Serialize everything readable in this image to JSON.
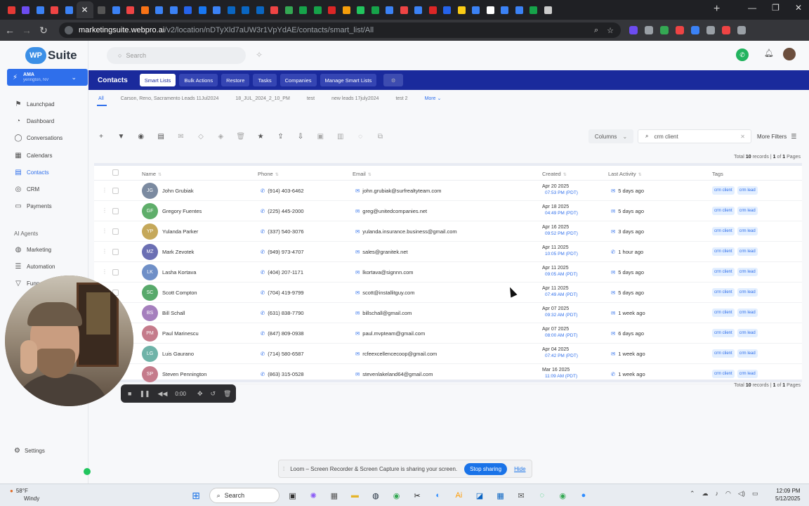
{
  "browser": {
    "url_host": "marketingsuite.webpro.ai",
    "url_path": "/v2/location/nDTyXld7aUW3r1VpYdAE/contacts/smart_list/All",
    "tab_colors": [
      "#e53935",
      "#6d4cf0",
      "#3b82f6",
      "#ef4444",
      "#3b82f6",
      "#555",
      "#3b82f6",
      "#ef4444",
      "#f97316",
      "#3b82f6",
      "#3b82f6",
      "#2563eb",
      "#1877f2",
      "#3b82f6",
      "#0a66c2",
      "#0a66c2",
      "#0a66c2",
      "#ef4444",
      "#34a853",
      "#16a34a",
      "#16a34a",
      "#dc2626",
      "#f59e0b",
      "#22c55e",
      "#16a34a",
      "#3b82f6",
      "#ef4444",
      "#3b82f6",
      "#dc2626",
      "#2563eb",
      "#facc15",
      "#3b82f6",
      "#ffffff",
      "#3b82f6",
      "#3b82f6",
      "#16a34a",
      "#cccccc"
    ],
    "ext_colors": [
      "#6d4cf0",
      "#9aa0a6",
      "#34a853",
      "#ef4444",
      "#3b82f6",
      "#9aa0a6",
      "#ef4444",
      "#9aa0a6"
    ]
  },
  "brand": {
    "logo_wp": "WP",
    "logo_suite": "Suite",
    "accent": "#2f6feb"
  },
  "location": {
    "name": "AMA",
    "sub": "yerington, NV"
  },
  "search": {
    "placeholder": "Search"
  },
  "sidebar": {
    "items": [
      {
        "label": "Launchpad",
        "icon": "rocket-icon"
      },
      {
        "label": "Dashboard",
        "icon": "gauge-icon"
      },
      {
        "label": "Conversations",
        "icon": "chat-icon"
      },
      {
        "label": "Calendars",
        "icon": "calendar-icon"
      },
      {
        "label": "Contacts",
        "icon": "contacts-icon"
      },
      {
        "label": "CRM",
        "icon": "pin-icon"
      },
      {
        "label": "Payments",
        "icon": "payments-icon"
      }
    ],
    "section_label": "AI Agents",
    "items2": [
      {
        "label": "Marketing",
        "icon": "globe-icon"
      },
      {
        "label": "Automation",
        "icon": "automation-icon"
      },
      {
        "label": "Funn",
        "icon": "funnel-icon"
      }
    ],
    "settings_label": "Settings"
  },
  "subnav": {
    "title": "Contacts",
    "buttons": [
      "Smart Lists",
      "Bulk Actions",
      "Restore",
      "Tasks",
      "Companies",
      "Manage Smart Lists"
    ]
  },
  "smart_lists": {
    "tabs": [
      "All",
      "Carson, Reno, Sacramento Leads 11Jul2024",
      "18_JUL_2024_2_10_PM",
      "test",
      "new leads 17july2024",
      "test 2"
    ],
    "more": "More"
  },
  "toolbar": {
    "columns_label": "Columns",
    "filter_value": "crm client",
    "more_filters_label": "More Filters"
  },
  "totals": {
    "prefix": "Total",
    "count": "10",
    "mid": "records |",
    "page": "1",
    "of": "of",
    "pages": "1",
    "suffix": "Pages"
  },
  "table": {
    "columns": [
      "Name",
      "Phone",
      "Email",
      "Created",
      "Last Activity",
      "Tags"
    ],
    "rows": [
      {
        "initials": "JG",
        "color": "#7b8aa0",
        "name": "John Grubiak",
        "phone": "(914) 403-6462",
        "email": "john.grubiak@surfrealtyteam.com",
        "created_date": "Apr 20 2025",
        "created_time": "07:53 PM (PDT)",
        "activity": "5 days ago",
        "activity_icon": "mail-icon",
        "tags": [
          "crm client",
          "crm lead"
        ]
      },
      {
        "initials": "GF",
        "color": "#5fae6a",
        "name": "Gregory Fuentes",
        "phone": "(225) 445-2000",
        "email": "greg@unitedcompanies.net",
        "created_date": "Apr 18 2025",
        "created_time": "04:49 PM (PDT)",
        "activity": "5 days ago",
        "activity_icon": "mail-icon",
        "tags": [
          "crm client",
          "crm lead"
        ]
      },
      {
        "initials": "YP",
        "color": "#c5a85a",
        "name": "Yulanda Parker",
        "phone": "(337) 540-3076",
        "email": "yulanda.insurance.business@gmail.com",
        "created_date": "Apr 16 2025",
        "created_time": "09:52 PM (PDT)",
        "activity": "3 days ago",
        "activity_icon": "mail-icon",
        "tags": [
          "crm client",
          "crm lead"
        ]
      },
      {
        "initials": "MZ",
        "color": "#6b6fb3",
        "name": "Mark Zevotek",
        "phone": "(949) 973-4707",
        "email": "sales@granitek.net",
        "created_date": "Apr 11 2025",
        "created_time": "10:05 PM (PDT)",
        "activity": "1 hour ago",
        "activity_icon": "phone-icon",
        "tags": [
          "crm client",
          "crm lead"
        ]
      },
      {
        "initials": "LK",
        "color": "#6f8fc7",
        "name": "Lasha Kortava",
        "phone": "(404) 207-1171",
        "email": "lkortava@signnn.com",
        "created_date": "Apr 11 2025",
        "created_time": "09:05 AM (PDT)",
        "activity": "5 days ago",
        "activity_icon": "mail-icon",
        "tags": [
          "crm client",
          "crm lead"
        ]
      },
      {
        "initials": "SC",
        "color": "#58a96b",
        "name": "Scott Compton",
        "phone": "(704) 419-9799",
        "email": "scott@installitguy.com",
        "created_date": "Apr 11 2025",
        "created_time": "07:49 AM (PDT)",
        "activity": "5 days ago",
        "activity_icon": "mail-icon",
        "tags": [
          "crm client",
          "crm lead"
        ]
      },
      {
        "initials": "BS",
        "color": "#a57fbd",
        "name": "Bill Schall",
        "phone": "(631) 838-7790",
        "email": "billschall@gmail.com",
        "created_date": "Apr 07 2025",
        "created_time": "09:32 AM (PDT)",
        "activity": "1 week ago",
        "activity_icon": "mail-icon",
        "tags": [
          "crm client",
          "crm lead"
        ]
      },
      {
        "initials": "PM",
        "color": "#c57b8b",
        "name": "Paul Marinescu",
        "phone": "(847) 809-0938",
        "email": "paul.mvpteam@gmail.com",
        "created_date": "Apr 07 2025",
        "created_time": "08:00 AM (PDT)",
        "activity": "6 days ago",
        "activity_icon": "mail-icon",
        "tags": [
          "crm client",
          "crm lead"
        ]
      },
      {
        "initials": "LG",
        "color": "#6fb3a8",
        "name": "Luis Gaurano",
        "phone": "(714) 580-6587",
        "email": "rcfeexcellencecoop@gmail.com",
        "created_date": "Apr 04 2025",
        "created_time": "07:42 PM (PDT)",
        "activity": "1 week ago",
        "activity_icon": "mail-icon",
        "tags": [
          "crm client",
          "crm lead"
        ]
      },
      {
        "initials": "SP",
        "color": "#c57b8b",
        "name": "Steven Pennington",
        "phone": "(863) 315-0528",
        "email": "stevenlakeland64@gmail.com",
        "created_date": "Mar 16 2025",
        "created_time": "11:09 AM (PDT)",
        "activity": "1 week ago",
        "activity_icon": "phone-icon",
        "tags": [
          "crm client",
          "crm lead"
        ]
      }
    ]
  },
  "recorder": {
    "time": "0:00"
  },
  "loom": {
    "message": "Loom – Screen Recorder & Screen Capture is sharing your screen.",
    "stop_label": "Stop sharing",
    "hide_label": "Hide"
  },
  "taskbar": {
    "weather_temp": "58°F",
    "weather_desc": "Windy",
    "search_label": "Search",
    "time": "12:09 PM",
    "date": "5/12/2025"
  }
}
